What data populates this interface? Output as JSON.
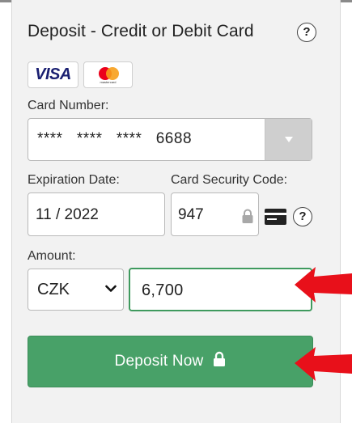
{
  "header": {
    "title": "Deposit - Credit or Debit Card",
    "help_icon": "question-circle-icon",
    "help_label": "?"
  },
  "card_logos": {
    "visa_text": "VISA",
    "mastercard_text": "mastercard"
  },
  "card_number": {
    "label": "Card Number:",
    "value": "****   ****   ****   6688",
    "dropdown_icon": "triangle-down-icon"
  },
  "expiration": {
    "label": "Expiration Date:",
    "value": "11 / 2022"
  },
  "security_code": {
    "label": "Card Security Code:",
    "value": "947",
    "lock_icon": "lock-icon",
    "card_icon": "credit-card-icon",
    "help_label": "?"
  },
  "amount": {
    "label": "Amount:",
    "currency": "CZK",
    "value": "6,700",
    "chevron_icon": "chevron-down-icon"
  },
  "deposit_button": {
    "label": "Deposit Now",
    "icon": "lock-icon"
  },
  "colors": {
    "accent_green": "#48a168",
    "annotation_red": "#e8101a",
    "panel_bg": "#f2f2f2"
  }
}
